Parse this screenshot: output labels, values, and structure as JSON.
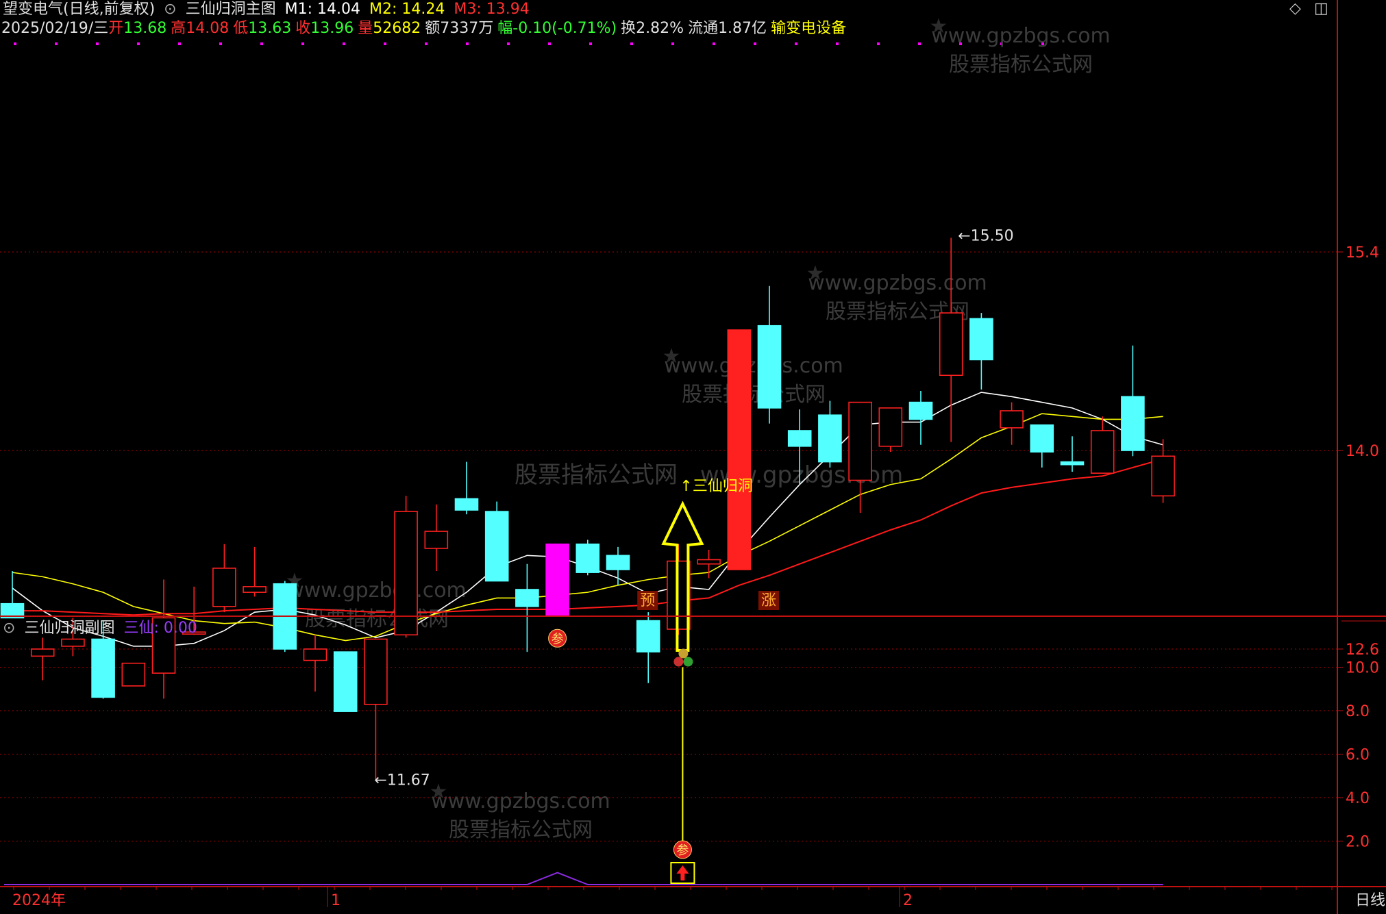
{
  "header": {
    "stock_title": "望变电气(日线,前复权)",
    "indicator_main": "三仙归洞主图",
    "m1": "M1: 14.04",
    "m2": "M2: 14.24",
    "m3": "M3: 13.94",
    "date": "2025/02/19/三",
    "open_label": "开",
    "open": "13.68",
    "high_label": "高",
    "high": "14.08",
    "low_label": "低",
    "low": "13.63",
    "close_label": "收",
    "close": "13.96",
    "vol_label": "量",
    "vol": "52682",
    "amount": "额7337万",
    "change_label": "幅",
    "change": "-0.10(-0.71%)",
    "turnover": "换2.82%",
    "float": "流通1.87亿",
    "sector": "输变电设备"
  },
  "sub": {
    "indicator_sub": "三仙归洞副图",
    "value_label": "三仙: 0.00"
  },
  "watermark": {
    "url": "www.gpzbgs.com",
    "name": "股票指标公式网"
  },
  "annotations": {
    "signal_text": "↑三仙归洞",
    "yu": "预",
    "zhang": "涨",
    "can": "参",
    "low_mark": "←11.67",
    "high_mark": "←15.50"
  },
  "time_axis": {
    "start": "2024年",
    "m1": "1",
    "m2": "2",
    "period": "日线"
  },
  "colors": {
    "up": "#ff2020",
    "down": "#54ffff",
    "ma_white": "#ffffff",
    "ma_yellow": "#ffff00",
    "ma_red": "#ff1a1a",
    "grid": "#c01010",
    "signal": "#ffff00",
    "purple": "#8b2be2",
    "magenta": "#ff00ff"
  },
  "chart_data": [
    {
      "type": "candlestick",
      "title": "三仙归洞主图",
      "ylim": [
        10.6,
        15.9
      ],
      "y_ticks": [
        12.6,
        14.0,
        15.4
      ],
      "candles": [
        {
          "o": 12.92,
          "h": 13.15,
          "l": 12.86,
          "c": 12.82,
          "hl": "down"
        },
        {
          "o": 12.55,
          "h": 12.68,
          "l": 12.38,
          "c": 12.6
        },
        {
          "o": 12.62,
          "h": 12.82,
          "l": 12.55,
          "c": 12.67
        },
        {
          "o": 12.67,
          "h": 12.8,
          "l": 12.25,
          "c": 12.26
        },
        {
          "o": 12.34,
          "h": 12.5,
          "l": 12.34,
          "c": 12.5
        },
        {
          "o": 12.43,
          "h": 13.09,
          "l": 12.25,
          "c": 12.82
        },
        {
          "o": 12.72,
          "h": 13.04,
          "l": 12.7,
          "c": 12.72
        },
        {
          "o": 12.9,
          "h": 13.34,
          "l": 12.86,
          "c": 13.17
        },
        {
          "o": 13.0,
          "h": 13.32,
          "l": 12.97,
          "c": 13.04
        },
        {
          "o": 13.06,
          "h": 13.08,
          "l": 12.58,
          "c": 12.6
        },
        {
          "o": 12.52,
          "h": 12.7,
          "l": 12.3,
          "c": 12.6
        },
        {
          "o": 12.58,
          "h": 12.58,
          "l": 12.16,
          "c": 12.16
        },
        {
          "o": 12.21,
          "h": 12.67,
          "l": 11.67,
          "c": 12.67
        },
        {
          "o": 12.7,
          "h": 13.68,
          "l": 12.68,
          "c": 13.57
        },
        {
          "o": 13.31,
          "h": 13.62,
          "l": 13.15,
          "c": 13.43
        },
        {
          "o": 13.66,
          "h": 13.92,
          "l": 13.55,
          "c": 13.58
        },
        {
          "o": 13.57,
          "h": 13.64,
          "l": 13.08,
          "c": 13.08
        },
        {
          "o": 13.02,
          "h": 13.2,
          "l": 12.58,
          "c": 12.9
        },
        {
          "o": 13.34,
          "h": 13.34,
          "l": 12.84,
          "c": 12.84,
          "special": "magenta"
        },
        {
          "o": 13.34,
          "h": 13.37,
          "l": 13.12,
          "c": 13.14
        },
        {
          "o": 13.26,
          "h": 13.32,
          "l": 13.05,
          "c": 13.16
        },
        {
          "o": 12.8,
          "h": 12.86,
          "l": 12.36,
          "c": 12.58
        },
        {
          "o": 12.74,
          "h": 13.34,
          "l": 12.7,
          "c": 13.22
        },
        {
          "o": 13.2,
          "h": 13.3,
          "l": 13.1,
          "c": 13.23
        },
        {
          "o": 13.16,
          "h": 14.85,
          "l": 13.16,
          "c": 14.85
        },
        {
          "o": 14.88,
          "h": 15.16,
          "l": 14.19,
          "c": 14.3
        },
        {
          "o": 14.14,
          "h": 14.29,
          "l": 13.76,
          "c": 14.03
        },
        {
          "o": 14.25,
          "h": 14.35,
          "l": 13.88,
          "c": 13.92
        },
        {
          "o": 13.79,
          "h": 14.34,
          "l": 13.56,
          "c": 14.34
        },
        {
          "o": 14.03,
          "h": 14.3,
          "l": 13.99,
          "c": 14.3
        },
        {
          "o": 14.34,
          "h": 14.42,
          "l": 14.04,
          "c": 14.22
        },
        {
          "o": 14.53,
          "h": 15.5,
          "l": 14.06,
          "c": 14.97
        },
        {
          "o": 14.93,
          "h": 14.97,
          "l": 14.43,
          "c": 14.64
        },
        {
          "o": 14.16,
          "h": 14.34,
          "l": 14.04,
          "c": 14.28
        },
        {
          "o": 14.18,
          "h": 14.18,
          "l": 13.88,
          "c": 13.99
        },
        {
          "o": 13.92,
          "h": 14.1,
          "l": 13.85,
          "c": 13.9
        },
        {
          "o": 13.84,
          "h": 14.24,
          "l": 13.84,
          "c": 14.14
        },
        {
          "o": 14.38,
          "h": 14.74,
          "l": 13.96,
          "c": 14.0
        },
        {
          "o": 13.68,
          "h": 14.08,
          "l": 13.63,
          "c": 13.96
        }
      ],
      "series": [
        {
          "name": "M1",
          "color": "white",
          "values": [
            13.03,
            12.87,
            12.75,
            12.69,
            12.62,
            12.62,
            12.64,
            12.73,
            12.86,
            12.88,
            12.84,
            12.77,
            12.68,
            12.73,
            12.86,
            13.0,
            13.18,
            13.26,
            13.25,
            13.18,
            13.1,
            12.99,
            13.04,
            13.02,
            13.29,
            13.53,
            13.76,
            13.97,
            14.18,
            14.2,
            14.2,
            14.32,
            14.41,
            14.38,
            14.34,
            14.3,
            14.22,
            14.1,
            14.04
          ]
        },
        {
          "name": "M2",
          "color": "yellow",
          "values": [
            13.14,
            13.11,
            13.06,
            13.0,
            12.9,
            12.85,
            12.8,
            12.78,
            12.79,
            12.75,
            12.7,
            12.66,
            12.69,
            12.78,
            12.85,
            12.91,
            12.96,
            12.96,
            12.98,
            13.0,
            13.05,
            13.09,
            13.12,
            13.14,
            13.26,
            13.36,
            13.47,
            13.58,
            13.69,
            13.76,
            13.8,
            13.94,
            14.09,
            14.17,
            14.26,
            14.24,
            14.22,
            14.22,
            14.24
          ]
        },
        {
          "name": "M3",
          "color": "red",
          "values": [
            12.87,
            12.87,
            12.86,
            12.85,
            12.84,
            12.85,
            12.85,
            12.87,
            12.88,
            12.89,
            12.88,
            12.87,
            12.86,
            12.86,
            12.86,
            12.87,
            12.88,
            12.88,
            12.88,
            12.89,
            12.9,
            12.91,
            12.94,
            12.96,
            13.05,
            13.12,
            13.2,
            13.28,
            13.36,
            13.44,
            13.51,
            13.61,
            13.7,
            13.74,
            13.77,
            13.8,
            13.82,
            13.88,
            13.94
          ]
        }
      ]
    },
    {
      "type": "line",
      "title": "三仙归洞副图",
      "ylim": [
        0,
        12.5
      ],
      "y_ticks": [
        2.0,
        4.0,
        6.0,
        8.0,
        10.0
      ],
      "series": [
        {
          "name": "三仙",
          "color": "purple",
          "values": [
            0,
            0,
            0,
            0,
            0,
            0,
            0,
            0,
            0,
            0,
            0,
            0,
            0,
            0,
            0,
            0,
            0,
            0,
            0.55,
            0,
            0,
            0,
            0,
            0,
            0,
            0,
            0,
            0,
            0,
            0,
            0,
            0,
            0,
            0,
            0,
            0,
            0,
            0,
            0
          ]
        }
      ],
      "signal": {
        "index": 22,
        "value": 10.0
      }
    }
  ]
}
